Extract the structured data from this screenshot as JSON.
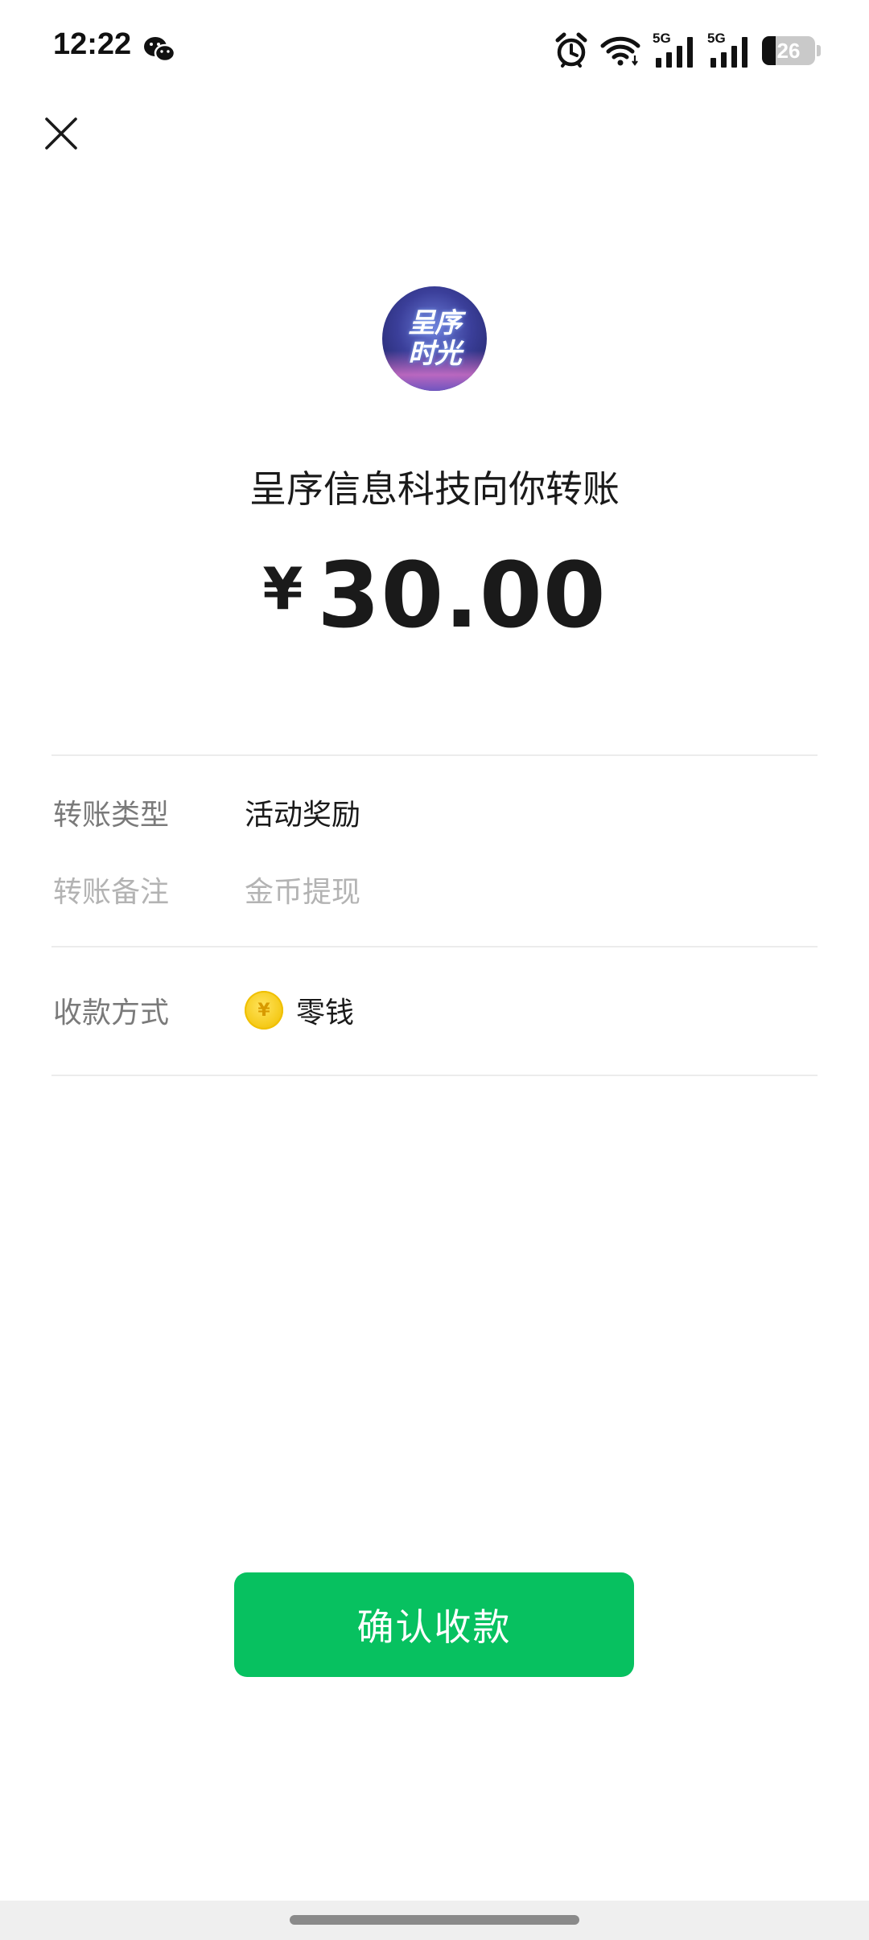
{
  "status_bar": {
    "time": "12:22",
    "network_label_1": "5G",
    "network_label_2": "5G",
    "battery_level": "26",
    "battery_fraction": 0.26
  },
  "icons": {
    "close": "close-icon",
    "wechat": "wechat-icon",
    "alarm": "alarm-icon",
    "wifi": "wifi-icon",
    "signal": "signal-icon",
    "battery": "battery-icon",
    "coin": "coin-icon"
  },
  "avatar": {
    "line1": "呈序",
    "line2": "时光"
  },
  "transfer": {
    "title": "呈序信息科技向你转账",
    "currency_symbol": "¥",
    "amount": "30.00"
  },
  "details": {
    "type_label": "转账类型",
    "type_value": "活动奖励",
    "note_label": "转账备注",
    "note_value": "金币提现",
    "method_label": "收款方式",
    "method_value": "零钱",
    "coin_symbol": "¥"
  },
  "actions": {
    "confirm_label": "确认收款"
  },
  "colors": {
    "accent": "#07c160",
    "text_primary": "#1a1a1a",
    "text_secondary": "#7a7a7a",
    "text_muted": "#b3b3b3",
    "divider": "#ececec"
  }
}
